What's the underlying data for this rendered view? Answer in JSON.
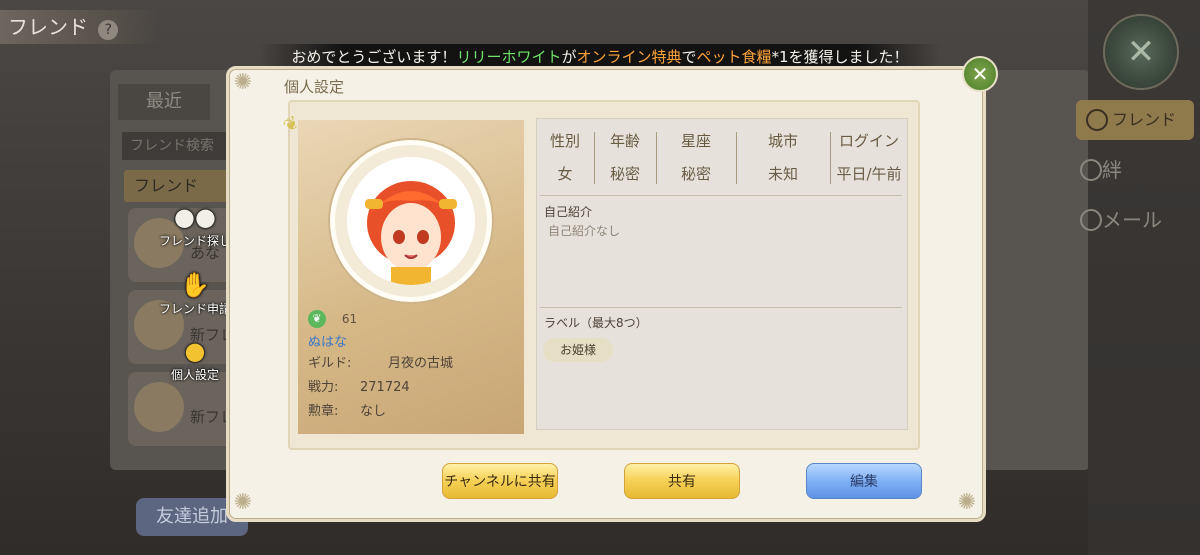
{
  "background": {
    "screen_title": "フレンド",
    "help_icon": "?",
    "tab_recent": "最近",
    "search_placeholder": "フレンド検索",
    "friend_tab": "フレンド",
    "list_items": [
      "あな",
      "新フレ",
      "新フレ"
    ],
    "add_friend_button": "友達追加",
    "side_tabs": [
      "フレンド",
      "絆",
      "メール"
    ]
  },
  "floating_menu": [
    {
      "label": "フレンド探し",
      "icon": "people-icon"
    },
    {
      "label": "フレンド申請",
      "icon": "handshake-icon"
    },
    {
      "label": "個人設定",
      "icon": "profile-settings-icon"
    }
  ],
  "banner": {
    "prefix": "おめでとうございます！",
    "player": "リリーホワイト",
    "mid1": "が",
    "event": "オンライン特典",
    "mid2": "で",
    "item": "ペット食糧",
    "suffix": "*1を獲得しました！"
  },
  "dialog": {
    "title": "個人設定",
    "profile": {
      "level": "61",
      "name": "ぬはな",
      "guild_label": "ギルド:",
      "guild_value": "月夜の古城",
      "power_label": "戦力:",
      "power_value": "271724",
      "medal_label": "勲章:",
      "medal_value": "なし"
    },
    "stats": {
      "headers": [
        "性別",
        "年齢",
        "星座",
        "城市",
        "ログイン"
      ],
      "values": [
        "女",
        "秘密",
        "秘密",
        "未知",
        "平日/午前"
      ]
    },
    "intro_title": "自己紹介",
    "intro_body": "自己紹介なし",
    "labels_title": "ラベル（最大8つ）",
    "labels": [
      "お姫様"
    ],
    "buttons": {
      "share_channel": "チャンネルに共有",
      "share": "共有",
      "edit": "編集"
    }
  },
  "colors": {
    "banner_green": "#6fe26a",
    "banner_orange": "#ffa23a",
    "name_blue": "#3d78c7",
    "button_gold": "#f7d35a",
    "button_blue": "#7fb1f5"
  }
}
